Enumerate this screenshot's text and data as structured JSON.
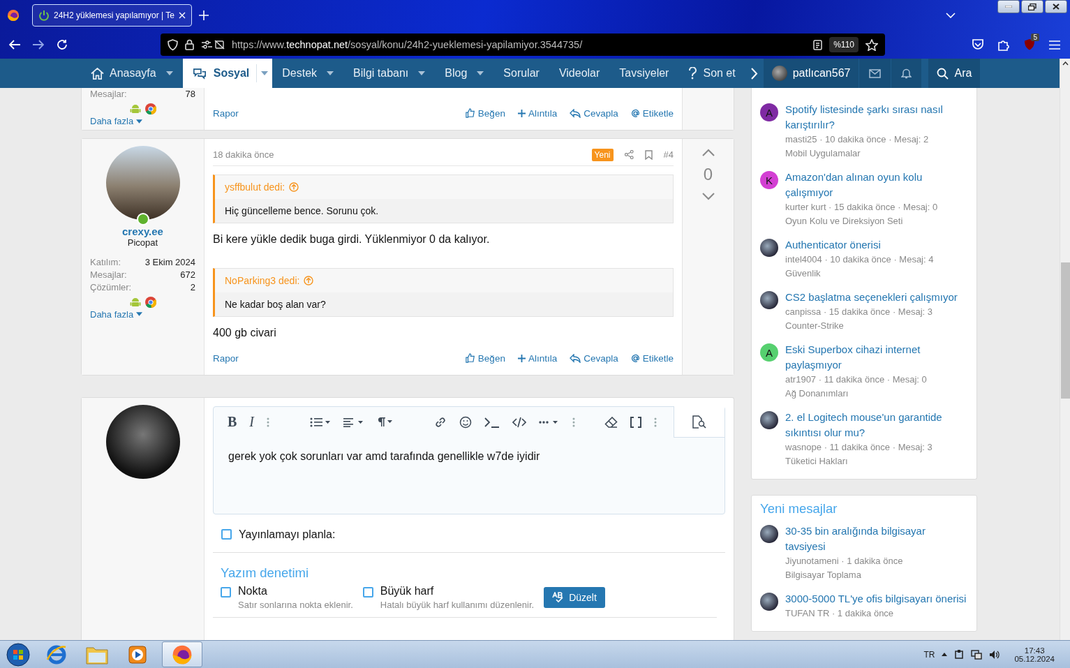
{
  "browser": {
    "tab_title": "24H2 yüklemesi yapılamıyor | Te",
    "url": {
      "prefix": "https://www.",
      "host": "technopat.net",
      "path": "/sosyal/konu/24h2-yueklemesi-yapilamiyor.3544735/"
    },
    "zoom": "%110",
    "extension_badge": "5"
  },
  "site_nav": {
    "items": [
      {
        "label": "Anasayfa",
        "kind": "home",
        "dropdown": true,
        "selected": false
      },
      {
        "label": "Sosyal",
        "kind": "chat",
        "dropdown": true,
        "selected": true
      },
      {
        "label": "Destek",
        "kind": "text",
        "dropdown": true,
        "selected": false
      },
      {
        "label": "Bilgi tabanı",
        "kind": "text",
        "dropdown": true,
        "selected": false
      },
      {
        "label": "Blog",
        "kind": "text",
        "dropdown": true,
        "selected": false
      },
      {
        "label": "Sorular",
        "kind": "text",
        "dropdown": false,
        "selected": false
      },
      {
        "label": "Videolar",
        "kind": "text",
        "dropdown": false,
        "selected": false
      },
      {
        "label": "Tavsiyeler",
        "kind": "text",
        "dropdown": false,
        "selected": false
      },
      {
        "label": "Son et",
        "kind": "question",
        "dropdown": false,
        "selected": false
      }
    ],
    "user": "patlıcan567",
    "search": "Ara"
  },
  "previous_post": {
    "stats": [
      {
        "label": "Mesajlar:",
        "value": "78"
      }
    ],
    "more": "Daha fazla",
    "report": "Rapor",
    "actions": [
      "Beğen",
      "Alıntıla",
      "Cevapla",
      "Etiketle"
    ]
  },
  "post": {
    "username": "crexy.ee",
    "user_title": "Picopat",
    "online": true,
    "stats": [
      {
        "label": "Katılım:",
        "value": "3 Ekim 2024"
      },
      {
        "label": "Mesajlar:",
        "value": "672"
      },
      {
        "label": "Çözümler:",
        "value": "2"
      }
    ],
    "more": "Daha fazla",
    "time": "18 dakika önce",
    "badge": "Yeni",
    "number": "#4",
    "votes": "0",
    "content": [
      {
        "kind": "quote",
        "author": "ysffbulut dedi:",
        "text": "Hiç güncelleme bence. Sorunu çok."
      },
      {
        "kind": "text",
        "text": "Bi kere yükle dedik buga girdi. Yüklenmiyor 0 da kalıyor."
      },
      {
        "kind": "quote",
        "author": "NoParking3 dedi:",
        "text": "Ne kadar boş alan var?"
      },
      {
        "kind": "text",
        "text": "400 gb civari"
      }
    ],
    "report": "Rapor",
    "actions": [
      "Beğen",
      "Alıntıla",
      "Cevapla",
      "Etiketle"
    ]
  },
  "reply_editor": {
    "toolbar": {
      "bold": "B",
      "italic": "I"
    },
    "text": "gerek yok çok sorunları var amd tarafında genellikle w7de iyidir",
    "schedule": {
      "label": "Yayınlamayı planla:",
      "checked": false
    },
    "spellcheck": {
      "title": "Yazım denetimi",
      "options": [
        {
          "label": "Nokta",
          "hint": "Satır sonlarına nokta eklenir.",
          "checked": false
        },
        {
          "label": "Büyük harf",
          "hint": "Hatalı büyük harf kullanımı düzenlenir.",
          "checked": false
        }
      ],
      "button": "Düzelt"
    }
  },
  "sidebar": {
    "threads": [
      {
        "kind": "letter",
        "letter": "A",
        "color": "#7f2aa3",
        "title": "Spotify listesinde şarkı sırası nasıl karıştırılır?",
        "meta": "masti25 · 10 dakika önce · Mesaj: 2",
        "forum": "Mobil Uygulamalar"
      },
      {
        "kind": "letter",
        "letter": "K",
        "color": "#d33fd3",
        "title": "Amazon'dan alınan oyun kolu çalışmıyor",
        "meta": "kurter kurt · 15 dakika önce · Mesaj: 0",
        "forum": "Oyun Kolu ve Direksiyon Seti"
      },
      {
        "kind": "photo",
        "title": "Authenticator önerisi",
        "meta": "intel4004 · 10 dakika önce · Mesaj: 4",
        "forum": "Güvenlik"
      },
      {
        "kind": "photo",
        "title": "CS2 başlatma seçenekleri çalışmıyor",
        "meta": "canpissa · 15 dakika önce · Mesaj: 3",
        "forum": "Counter-Strike"
      },
      {
        "kind": "letter",
        "letter": "A",
        "color": "#56d06f",
        "title": "Eski Superbox cihazi internet paylaşmıyor",
        "meta": "atr1907 · 11 dakika önce · Mesaj: 0",
        "forum": "Ağ Donanımları"
      },
      {
        "kind": "photo",
        "title": "2. el Logitech mouse'un garantide sıkıntısı olur mu?",
        "meta": "wasnope · 11 dakika önce · Mesaj: 3",
        "forum": "Tüketici Hakları"
      }
    ],
    "new_messages": {
      "title": "Yeni mesajlar",
      "threads": [
        {
          "kind": "photo",
          "title": "30-35 bin aralığında bilgisayar tavsiyesi",
          "meta": "Jiyunotameni · 1 dakika önce",
          "forum": "Bilgisayar Toplama"
        },
        {
          "kind": "photo",
          "title": "3000-5000 TL'ye ofis bilgisayarı önerisi",
          "meta": "TUFAN TR · 1 dakika önce"
        }
      ]
    }
  },
  "taskbar": {
    "language": "TR",
    "time": "17:43",
    "date": "05.12.2024"
  }
}
